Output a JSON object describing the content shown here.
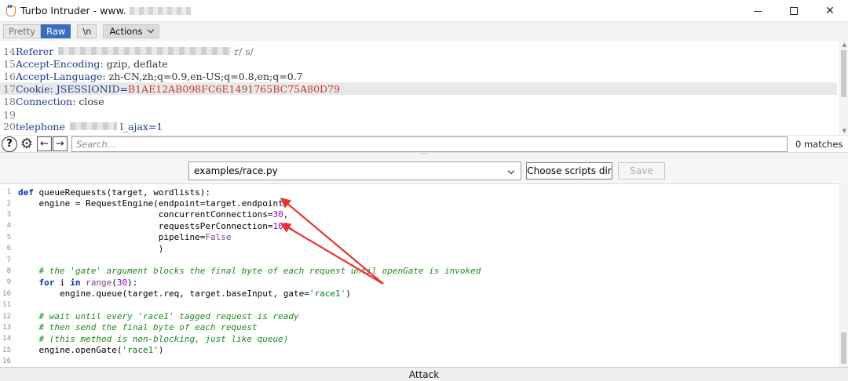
{
  "window": {
    "title": "Turbo Intruder - www.",
    "controls": {
      "minimize": "minimize-icon",
      "maximize": "maximize-icon",
      "close": "close-icon"
    }
  },
  "toolbar": {
    "pretty_label": "Pretty",
    "raw_label": "Raw",
    "newline_label": "\\n",
    "actions_label": "Actions"
  },
  "request_lines": [
    {
      "num": "14",
      "key": "Referer",
      "value": "",
      "redacted": true,
      "tail": "r/ s/"
    },
    {
      "num": "15",
      "key": "Accept-Encoding",
      "value": ": gzip, deflate"
    },
    {
      "num": "16",
      "key": "Accept-Language",
      "value": ": zh-CN,zh;q=0.9,en-US;q=0.8,en;q=0.7"
    },
    {
      "num": "17",
      "key": "Cookie",
      "value": ": JSESSIONID=",
      "cookie": "B1AE12AB098FC6E1491765BC75A80D79"
    },
    {
      "num": "18",
      "key": "Connection",
      "value": ": close"
    },
    {
      "num": "19",
      "key": "",
      "value": ""
    },
    {
      "num": "20",
      "key": "telephone",
      "value": "",
      "redacted": true,
      "tail": "l_ajax=1"
    }
  ],
  "search": {
    "help_icon": "help-icon",
    "settings_icon": "gear-icon",
    "prev_icon": "arrow-left-icon",
    "next_icon": "arrow-right-icon",
    "placeholder": "Search...",
    "matches": "0 matches"
  },
  "script_bar": {
    "selected_script": "examples/race.py",
    "choose_label": "Choose scripts dir",
    "save_label": "Save"
  },
  "code_lines": [
    {
      "num": "1",
      "tokens": [
        [
          "kw",
          "def"
        ],
        [
          "tx",
          " queueRequests(target, wordlists):"
        ]
      ]
    },
    {
      "num": "2",
      "tokens": [
        [
          "tx",
          "    engine = RequestEngine(endpoint=target.endpoint,"
        ]
      ]
    },
    {
      "num": "3",
      "tokens": [
        [
          "tx",
          "                           concurrentConnections="
        ],
        [
          "num",
          "30"
        ],
        [
          "tx",
          ","
        ]
      ]
    },
    {
      "num": "4",
      "tokens": [
        [
          "tx",
          "                           requestsPerConnection="
        ],
        [
          "num",
          "100"
        ],
        [
          "tx",
          ","
        ]
      ]
    },
    {
      "num": "5",
      "tokens": [
        [
          "tx",
          "                           pipeline="
        ],
        [
          "bi",
          "False"
        ]
      ]
    },
    {
      "num": "6",
      "tokens": [
        [
          "tx",
          "                           )"
        ]
      ]
    },
    {
      "num": "7",
      "tokens": []
    },
    {
      "num": "8",
      "tokens": [
        [
          "cm",
          "    # the 'gate' argument blocks the final byte of each request until openGate is invoked"
        ]
      ]
    },
    {
      "num": "9",
      "tokens": [
        [
          "kw",
          "    for"
        ],
        [
          "tx",
          " i "
        ],
        [
          "kw",
          "in"
        ],
        [
          "tx",
          " "
        ],
        [
          "bi",
          "range"
        ],
        [
          "tx",
          "("
        ],
        [
          "num",
          "30"
        ],
        [
          "tx",
          "):"
        ]
      ]
    },
    {
      "num": "10",
      "tokens": [
        [
          "tx",
          "        engine.queue(target.req, target.baseInput, gate="
        ],
        [
          "st",
          "'race1'"
        ],
        [
          "tx",
          ")"
        ]
      ]
    },
    {
      "num": "11",
      "tokens": []
    },
    {
      "num": "12",
      "tokens": [
        [
          "cm",
          "    # wait until every 'race1' tagged request is ready"
        ]
      ]
    },
    {
      "num": "13",
      "tokens": [
        [
          "cm",
          "    # then send the final byte of each request"
        ]
      ]
    },
    {
      "num": "14",
      "tokens": [
        [
          "cm",
          "    # (this method is non-blocking, just like queue)"
        ]
      ]
    },
    {
      "num": "15",
      "tokens": [
        [
          "tx",
          "    engine.openGate("
        ],
        [
          "st",
          "'race1'"
        ],
        [
          "tx",
          ")"
        ]
      ]
    },
    {
      "num": "16",
      "tokens": []
    }
  ],
  "attack_label": "Attack",
  "colors": {
    "raw_active": "#3c6cbf",
    "annotation_arrow": "#e8352f",
    "cookie_value": "#c0392b",
    "header_key": "#1f3b8a"
  }
}
